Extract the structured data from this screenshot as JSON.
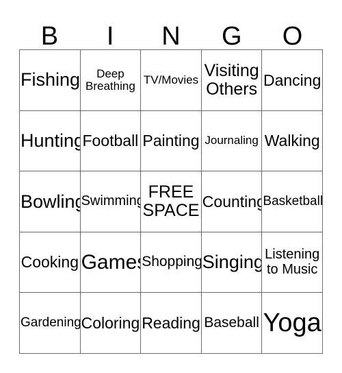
{
  "card": {
    "title": "BINGO",
    "header_letters": [
      "B",
      "I",
      "N",
      "G",
      "O"
    ],
    "free_space_label": "FREE\nSPACE",
    "border_color": "#6b6b6b",
    "text_color": "#000000",
    "background_color": "#ffffff",
    "rows": [
      [
        {
          "label": "Fishing",
          "size": "xl",
          "lines": 1
        },
        {
          "label": "Deep\nBreathing",
          "size": "xs",
          "lines": 2
        },
        {
          "label": "TV/Movies",
          "size": "xs",
          "lines": 1
        },
        {
          "label": "Visiting\nOthers",
          "size": "l",
          "lines": 2
        },
        {
          "label": "Dancing",
          "size": "ml",
          "lines": 1
        }
      ],
      [
        {
          "label": "Hunting",
          "size": "xl",
          "lines": 1
        },
        {
          "label": "Football",
          "size": "ml",
          "lines": 1
        },
        {
          "label": "Painting",
          "size": "ml",
          "lines": 1
        },
        {
          "label": "Journaling",
          "size": "xs",
          "lines": 1
        },
        {
          "label": "Walking",
          "size": "ml",
          "lines": 1
        }
      ],
      [
        {
          "label": "Bowling",
          "size": "xl",
          "lines": 1
        },
        {
          "label": "Swimming",
          "size": "sm",
          "lines": 1
        },
        {
          "label": "FREE\nSPACE",
          "size": "l",
          "lines": 2
        },
        {
          "label": "Counting",
          "size": "ml",
          "lines": 1
        },
        {
          "label": "Basketball",
          "size": "s",
          "lines": 1
        }
      ],
      [
        {
          "label": "Cooking",
          "size": "ml",
          "lines": 1
        },
        {
          "label": "Games",
          "size": "xxl",
          "lines": 1
        },
        {
          "label": "Shopping",
          "size": "m",
          "lines": 1
        },
        {
          "label": "Singing",
          "size": "xl",
          "lines": 1
        },
        {
          "label": "Listening\nto Music",
          "size": "sm",
          "lines": 2
        }
      ],
      [
        {
          "label": "Gardening",
          "size": "s",
          "lines": 1
        },
        {
          "label": "Coloring",
          "size": "ml",
          "lines": 1
        },
        {
          "label": "Reading",
          "size": "ml",
          "lines": 1
        },
        {
          "label": "Baseball",
          "size": "m",
          "lines": 1
        },
        {
          "label": "Yoga",
          "size": "huge",
          "lines": 1
        }
      ]
    ]
  }
}
